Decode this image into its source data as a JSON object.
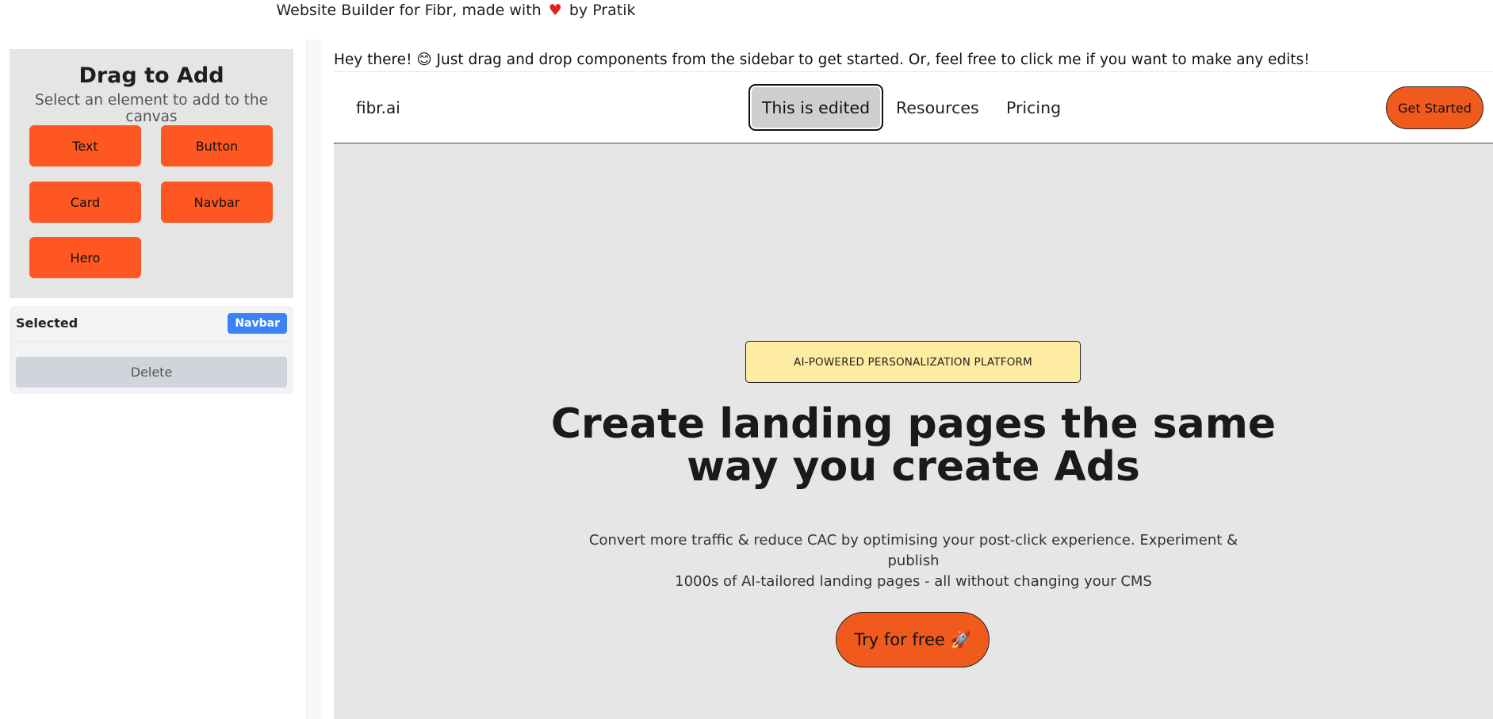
{
  "credit": {
    "prefix": "Website Builder for Fibr, made with",
    "heart_icon": "♥",
    "suffix": "by Pratik"
  },
  "sidebar": {
    "title": "Drag to Add",
    "subtitle": "Select an element to add to the canvas",
    "components": [
      "Text",
      "Button",
      "Card",
      "Navbar",
      "Hero"
    ],
    "accent_color": "#ff5722"
  },
  "selection": {
    "label": "Selected",
    "badge": "Navbar",
    "delete_label": "Delete"
  },
  "canvas": {
    "hint": "Hey there! 😊 Just drag and drop components from the sidebar to get started. Or, feel free to click me if you want to make any edits!",
    "navbar": {
      "logo": "fibr.ai",
      "links": [
        "This is edited",
        "Resources",
        "Pricing"
      ],
      "cta": "Get Started"
    },
    "hero": {
      "badge": "AI-POWERED PERSONALIZATION PLATFORM",
      "title_line1": "Create landing pages the same",
      "title_line2": "way you create Ads",
      "description_line1": "Convert more traffic & reduce CAC by optimising your post-click experience. Experiment & publish",
      "description_line2": "1000s of AI-tailored landing pages - all without changing your CMS",
      "cta": "Try for free 🚀"
    }
  }
}
